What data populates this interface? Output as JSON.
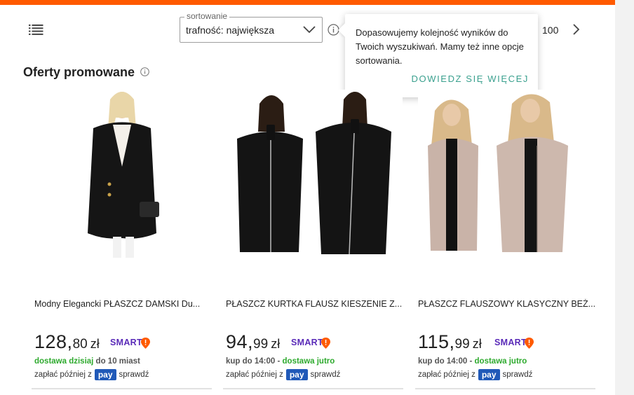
{
  "colors": {
    "brand": "#ff5a00",
    "link": "#3aa08e",
    "smart": "#5a2bb8",
    "green": "#2eaa2e",
    "payu": "#2059b8"
  },
  "toolbar": {
    "list_view_icon": "list-icon",
    "sort_label": "sortowanie",
    "sort_value": "trafność: największa",
    "page_count": "100",
    "next_icon": "chevron-right-icon"
  },
  "tooltip": {
    "text": "Dopasowujemy kolejność wyników do Twoich wyszukiwań. Mamy też inne opcje sortowania.",
    "link": "DOWIEDZ SIĘ WIĘCEJ"
  },
  "section": {
    "title": "Oferty promowane"
  },
  "products": [
    {
      "title": "Modny Elegancki PŁASZCZ DAMSKI Du...",
      "price_int": "128,",
      "price_dec": "80",
      "currency": "zł",
      "badge": "SMART",
      "delivery_green": "dostawa dzisiaj",
      "delivery_rest": " do 10 miast",
      "pay_prefix": "zapłać później z",
      "pay_logo": "pay",
      "pay_suffix": "sprawdź"
    },
    {
      "title": "PŁASZCZ KURTKA FLAUSZ KIESZENIE Z...",
      "price_int": "94,",
      "price_dec": "99",
      "currency": "zł",
      "badge": "SMART",
      "delivery_prefix": "kup do 14:00 - ",
      "delivery_green": "dostawa jutro",
      "pay_prefix": "zapłać później z",
      "pay_logo": "pay",
      "pay_suffix": "sprawdź"
    },
    {
      "title": "PŁASZCZ FLAUSZOWY KLASYCZNY BEŻ...",
      "price_int": "115,",
      "price_dec": "99",
      "currency": "zł",
      "badge": "SMART",
      "delivery_prefix": "kup do 14:00 - ",
      "delivery_green": "dostawa jutro",
      "pay_prefix": "zapłać później z",
      "pay_logo": "pay",
      "pay_suffix": "sprawdź"
    }
  ]
}
